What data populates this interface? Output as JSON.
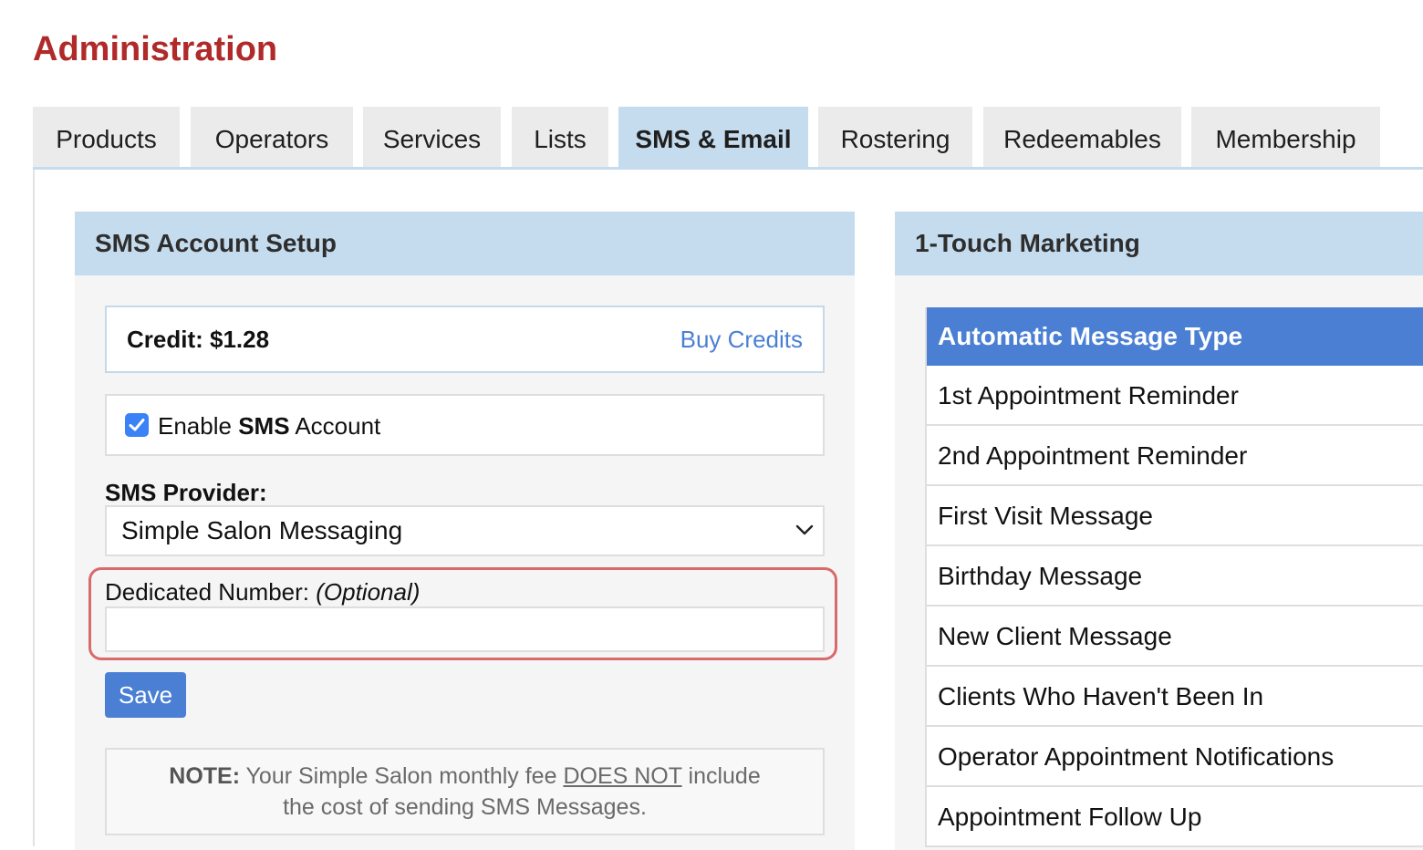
{
  "page": {
    "title": "Administration"
  },
  "tabs": [
    {
      "label": "Products"
    },
    {
      "label": "Operators"
    },
    {
      "label": "Services"
    },
    {
      "label": "Lists"
    },
    {
      "label": "SMS & Email"
    },
    {
      "label": "Rostering"
    },
    {
      "label": "Redeemables"
    },
    {
      "label": "Membership"
    }
  ],
  "active_tab": "SMS & Email",
  "sms_setup": {
    "header": "SMS Account Setup",
    "credit_text": "Credit: $1.28",
    "buy_credits": "Buy Credits",
    "enable_checked": true,
    "enable_label_prefix": "Enable ",
    "enable_label_bold": "SMS",
    "enable_label_suffix": " Account",
    "provider_label": "SMS Provider:",
    "provider_value": "Simple Salon Messaging",
    "dedicated_label": "Dedicated Number: ",
    "dedicated_optional": "(Optional)",
    "dedicated_value": "",
    "save_label": "Save",
    "note_bold": "NOTE:",
    "note_part1": " Your Simple Salon monthly fee ",
    "note_underline": "DOES NOT",
    "note_part2": " include",
    "note_line2": "the cost of sending SMS Messages."
  },
  "marketing": {
    "header": "1-Touch Marketing",
    "table_header": "Automatic Message Type",
    "rows": [
      "1st Appointment Reminder",
      "2nd Appointment Reminder",
      "First Visit Message",
      "Birthday Message",
      "New Client Message",
      "Clients Who Haven't Been In",
      "Operator Appointment Notifications",
      "Appointment Follow Up"
    ]
  },
  "colors": {
    "title": "#b02a2a",
    "tab_active": "#c5dcee",
    "accent_blue": "#4a7fd4",
    "highlight_red": "#d96a6a"
  }
}
